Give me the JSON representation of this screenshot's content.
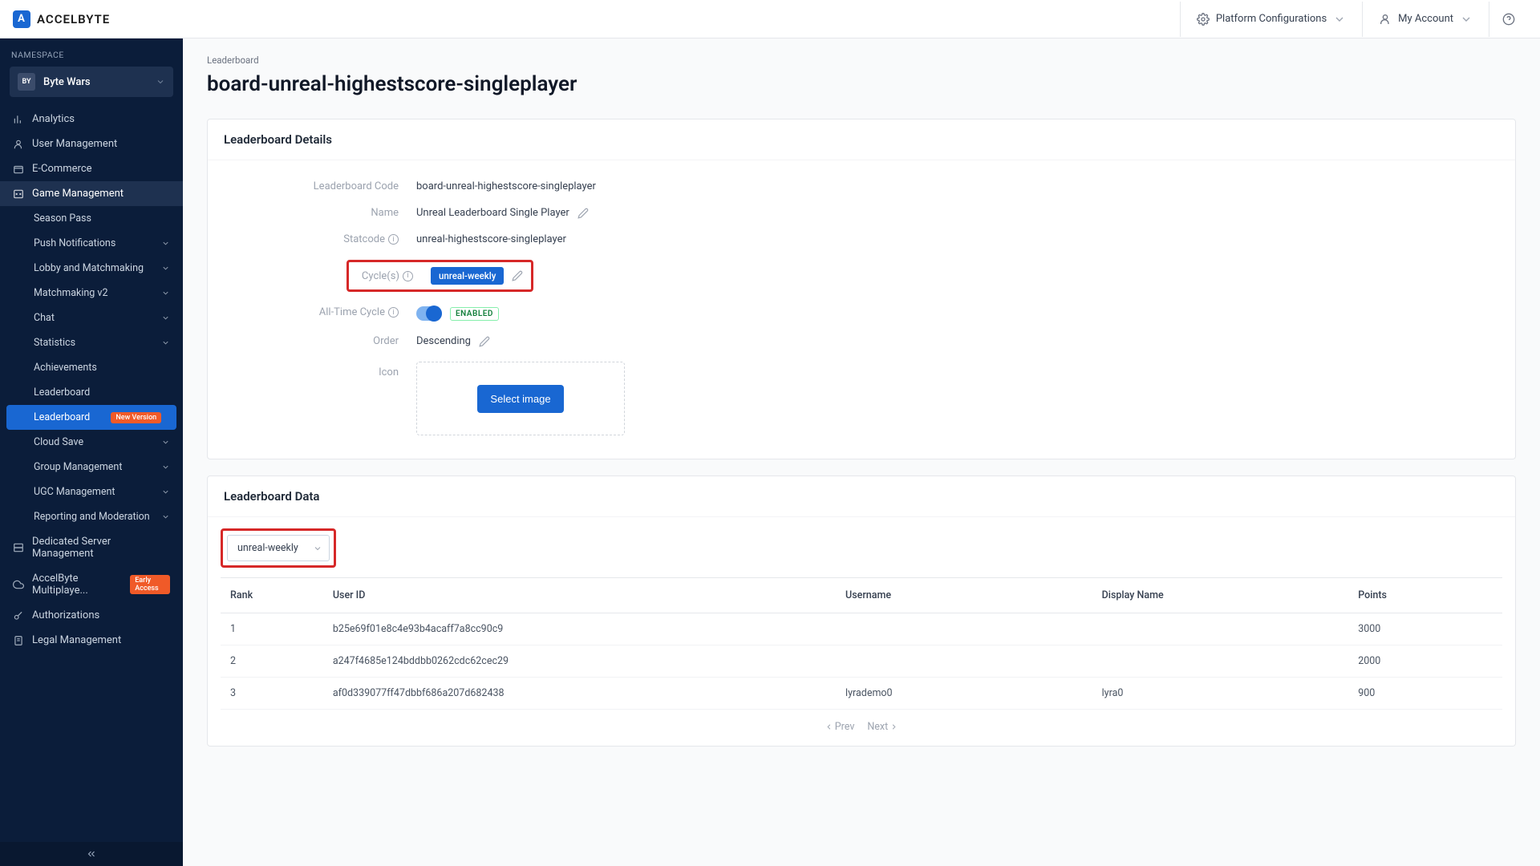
{
  "brand": "ACCELBYTE",
  "topbar": {
    "platform_config": "Platform Configurations",
    "my_account": "My Account"
  },
  "sidebar": {
    "namespace_label": "NAMESPACE",
    "namespace_badge": "BY",
    "namespace_name": "Byte Wars",
    "items": [
      {
        "icon": "analytics",
        "label": "Analytics"
      },
      {
        "icon": "user",
        "label": "User Management"
      },
      {
        "icon": "cart",
        "label": "E-Commerce"
      },
      {
        "icon": "game",
        "label": "Game Management",
        "active": true
      },
      {
        "icon": "server",
        "label": "Dedicated Server Management"
      },
      {
        "icon": "cloud",
        "label": "AccelByte Multiplaye...",
        "badge": "Early Access"
      },
      {
        "icon": "key",
        "label": "Authorizations"
      },
      {
        "icon": "doc",
        "label": "Legal Management"
      }
    ],
    "game_sub": [
      {
        "label": "Season Pass"
      },
      {
        "label": "Push Notifications",
        "expandable": true
      },
      {
        "label": "Lobby and Matchmaking",
        "expandable": true
      },
      {
        "label": "Matchmaking v2",
        "expandable": true
      },
      {
        "label": "Chat",
        "expandable": true
      },
      {
        "label": "Statistics",
        "expandable": true
      },
      {
        "label": "Achievements"
      },
      {
        "label": "Leaderboard"
      },
      {
        "label": "Leaderboard",
        "badge": "New Version",
        "selected": true
      },
      {
        "label": "Cloud Save",
        "expandable": true
      },
      {
        "label": "Group Management",
        "expandable": true
      },
      {
        "label": "UGC Management",
        "expandable": true
      },
      {
        "label": "Reporting and Moderation",
        "expandable": true
      }
    ]
  },
  "breadcrumb": "Leaderboard",
  "page_title": "board-unreal-highestscore-singleplayer",
  "details": {
    "card_title": "Leaderboard Details",
    "labels": {
      "code": "Leaderboard Code",
      "name": "Name",
      "statcode": "Statcode",
      "cycles": "Cycle(s)",
      "alltime": "All-Time Cycle",
      "order": "Order",
      "icon": "Icon"
    },
    "values": {
      "code": "board-unreal-highestscore-singleplayer",
      "name": "Unreal Leaderboard Single Player",
      "statcode": "unreal-highestscore-singleplayer",
      "cycle_tag": "unreal-weekly",
      "alltime_status": "ENABLED",
      "order": "Descending",
      "select_image_btn": "Select image"
    }
  },
  "data_card": {
    "title": "Leaderboard Data",
    "cycle_filter": "unreal-weekly",
    "columns": [
      "Rank",
      "User ID",
      "Username",
      "Display Name",
      "Points"
    ],
    "rows": [
      {
        "rank": "1",
        "user_id": "b25e69f01e8c4e93b4acaff7a8cc90c9",
        "username": "",
        "display": "",
        "points": "3000"
      },
      {
        "rank": "2",
        "user_id": "a247f4685e124bddbb0262cdc62cec29",
        "username": "",
        "display": "",
        "points": "2000"
      },
      {
        "rank": "3",
        "user_id": "af0d339077ff47dbbf686a207d682438",
        "username": "lyrademo0",
        "display": "lyra0",
        "points": "900"
      }
    ],
    "prev": "Prev",
    "next": "Next"
  }
}
